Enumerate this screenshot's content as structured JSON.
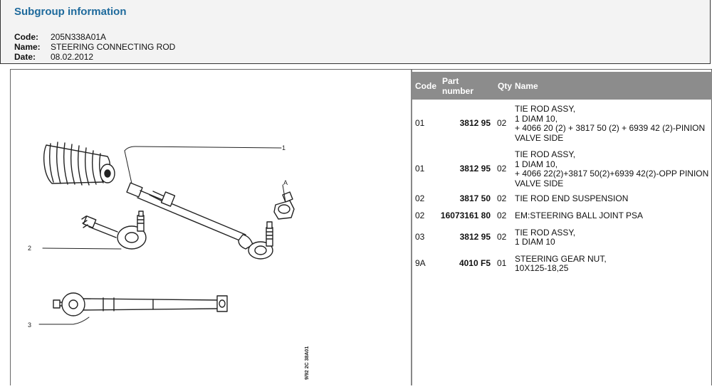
{
  "header": {
    "title": "Subgroup information",
    "fields": [
      {
        "label": "Code:",
        "value": "205N338A01A"
      },
      {
        "label": "Name:",
        "value": "STEERING CONNECTING ROD"
      },
      {
        "label": "Date:",
        "value": "08.02.2012"
      }
    ]
  },
  "drawing": {
    "callouts": [
      "1",
      "A",
      "2",
      "3"
    ],
    "stamp": "9/92 2C 38A01"
  },
  "table": {
    "headers": {
      "code": "Code",
      "part": "Part\nnumber",
      "qty": "Qty",
      "name": "Name"
    },
    "rows": [
      {
        "code": "01",
        "part": "3812 95",
        "qty": "02",
        "name": "TIE ROD ASSY,\n1 DIAM 10,\n+ 4066 20 (2) + 3817 50 (2) + 6939 42 (2)-PINION\nVALVE SIDE"
      },
      {
        "code": "01",
        "part": "3812 95",
        "qty": "02",
        "name": "TIE ROD ASSY,\n1 DIAM 10,\n+ 4066 22(2)+3817 50(2)+6939 42(2)-OPP PINION\nVALVE SIDE"
      },
      {
        "code": "02",
        "part": "3817 50",
        "qty": "02",
        "name": "TIE ROD END SUSPENSION"
      },
      {
        "code": "02",
        "part": "16073161 80",
        "qty": "02",
        "name": "EM:STEERING BALL JOINT PSA"
      },
      {
        "code": "03",
        "part": "3812 95",
        "qty": "02",
        "name": "TIE ROD ASSY,\n1 DIAM 10"
      },
      {
        "code": "9A",
        "part": "4010 F5",
        "qty": "01",
        "name": "STEERING GEAR NUT,\n10X125-18,25"
      }
    ]
  }
}
